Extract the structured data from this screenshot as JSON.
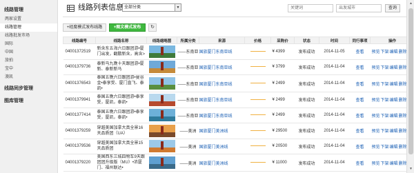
{
  "sidebar": {
    "groups": [
      {
        "label": "线路管理",
        "items": [
          "两家设置",
          "线路管理",
          "线路批发市场",
          "国际",
          "中国",
          "旅拍",
          "宝中",
          "澳凯"
        ]
      },
      {
        "label": "线路同步管理"
      },
      {
        "label": "图库管理"
      }
    ]
  },
  "header": {
    "title": "线路列表信息",
    "category_select": "全部分类",
    "keyword_placeholder": "关键词",
    "city_placeholder": "出发城市",
    "search_label": "查询"
  },
  "toolbar": {
    "add_classic_label": "+经度模式发布线路",
    "add_graphic_label": "+图文模式发布",
    "refresh_icon": "↻"
  },
  "table": {
    "columns": [
      "线路编号",
      "线路名称",
      "线路缩略图",
      "所属分类",
      "来源",
      "价格",
      "采购价",
      "状态",
      "时间",
      "同行事项",
      "操作"
    ],
    "rows": [
      {
        "code": "04001372519",
        "name": "新含东五海六日跟团游•厦门出发，翻鹏新含，高含>",
        "region": "——东南亚",
        "source": "国旅厦门东南亚线",
        "sale": "¥ 4399",
        "status": "发布成功",
        "time": "2014-11-05",
        "view": "查看",
        "ops": [
          "预览",
          "下架",
          "编辑",
          "删除"
        ]
      },
      {
        "code": "04001379736",
        "name": "泰新马九晚十天跟团游•厦新、泰新新马",
        "region": "——东南亚",
        "source": "国旅厦门东南亚线",
        "sale": "¥ 3799",
        "status": "发布成功",
        "time": "2014-11-04",
        "view": "查看",
        "ops": [
          "预览",
          "下架",
          "编辑",
          "删除"
        ]
      },
      {
        "code": "04001376543",
        "name": "泰国五晚六日跟团游•曼谷金•泰享受、厦门直飞、泰凯•",
        "region": "——东南亚",
        "source": "国旅厦门东南亚线",
        "sale": "¥ 2499",
        "status": "发布成功",
        "time": "2014-11-04",
        "view": "查看",
        "ops": [
          "预览",
          "下架",
          "编辑",
          "删除"
        ]
      },
      {
        "code": "04001379941",
        "name": "泰国五晚六日跟团游•泰享受，厦凯，泰凯•",
        "region": "——东南亚",
        "source": "国旅厦门东南亚线",
        "sale": "¥ 2499",
        "status": "发布成功",
        "time": "2014-11-04",
        "view": "查看",
        "ops": [
          "预览",
          "下架",
          "编辑",
          "删除"
        ]
      },
      {
        "code": "04001377414",
        "name": "泰国五晚六日跟团游•泰享受，厦凯，泰凯•",
        "region": "——东南亚",
        "source": "国旅厦门东南亚线",
        "sale": "¥ 2499",
        "status": "发布成功",
        "time": "2014-11-04",
        "view": "查看",
        "ops": [
          "预览",
          "下架",
          "编辑",
          "删除"
        ]
      },
      {
        "code": "04001379259",
        "name": "穿越美国加拿大真全景16天品质团（UA）",
        "region": "——美洲",
        "source": "国旅厦门美洲线",
        "sale": "¥ 29500",
        "status": "发布成功",
        "time": "2014-11-04",
        "view": "查看",
        "ops": [
          "预览",
          "下架",
          "编辑",
          "删除"
        ]
      },
      {
        "code": "04001379536",
        "name": "穿越美国加拿大真全景15天品质团",
        "region": "——美洲",
        "source": "国旅厦门美洲线",
        "sale": "¥ 20500",
        "status": "发布成功",
        "time": "2014-11-04",
        "view": "查看",
        "ops": [
          "预览",
          "下架",
          "编辑",
          "删除"
        ]
      },
      {
        "code": "04001379220",
        "name": "美国西东三城四物车9天跟团团升级版（MU）•浓厦门、福州联达•",
        "region": "——美洲",
        "source": "国旅厦门美洲线",
        "sale": "¥ 11000",
        "status": "发布成功",
        "time": "2014-11-04",
        "view": "查看",
        "ops": [
          "预览",
          "下架",
          "编辑",
          "删除"
        ]
      }
    ]
  },
  "thumb_colors": [
    {
      "sky": "#7ab8e0",
      "ground": "#3f7a3a"
    },
    {
      "sky": "#6fa9d8",
      "ground": "#c58a3a"
    },
    {
      "sky": "#8fc3e6",
      "ground": "#5a8f3f"
    },
    {
      "sky": "#b9d9ee",
      "ground": "#b64a2e"
    },
    {
      "sky": "#6db0d8",
      "ground": "#2f7b9c"
    },
    {
      "sky": "#e8a04a",
      "ground": "#7a4a2a"
    },
    {
      "sky": "#9cc9e8",
      "ground": "#d07a30"
    },
    {
      "sky": "#5f9fd0",
      "ground": "#3b6b8a"
    }
  ]
}
